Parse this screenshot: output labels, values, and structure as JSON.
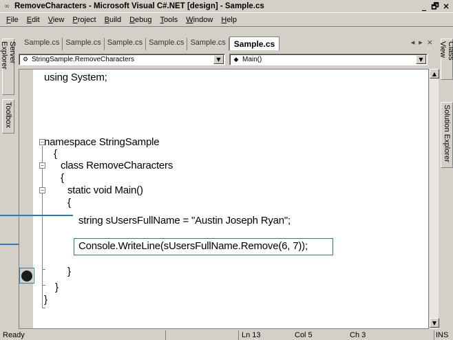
{
  "window": {
    "title": "RemoveCharacters - Microsoft Visual C#.NET [design] - Sample.cs",
    "app_icon": "visual-studio-icon"
  },
  "menu": {
    "items": [
      "File",
      "Edit",
      "View",
      "Project",
      "Build",
      "Debug",
      "Tools",
      "Window",
      "Help"
    ]
  },
  "left_dock": {
    "tabs": [
      "Server Explorer",
      "Toolbox"
    ]
  },
  "right_dock": {
    "tabs": [
      "Class View",
      "Solution Explorer"
    ]
  },
  "doc_tabs": {
    "tabs": [
      "Sample.cs",
      "Sample.cs",
      "Sample.cs",
      "Sample.cs",
      "Sample.cs"
    ],
    "active": "Sample.cs",
    "nav_left": "◂",
    "nav_right": "▸",
    "close": "×"
  },
  "dropdowns": {
    "class_selector": "StringSample.RemoveCharacters",
    "member_selector": "Main()"
  },
  "code": {
    "lines": [
      "using System;",
      "namespace StringSample",
      "{",
      "class RemoveCharacters",
      "{",
      "static void Main()",
      "{",
      "string sUsersFullName = \"Austin Joseph Ryan\";",
      "Console.WriteLine(sUsersFullName.Remove(6, 7));",
      "}",
      "}",
      "}"
    ]
  },
  "status": {
    "text": "Ready",
    "line": "Ln 13",
    "col": "Col 5",
    "ch": "Ch 3",
    "mode": "INS"
  },
  "colors": {
    "callout": "#2a7ab8",
    "chrome": "#d4d0c8"
  }
}
